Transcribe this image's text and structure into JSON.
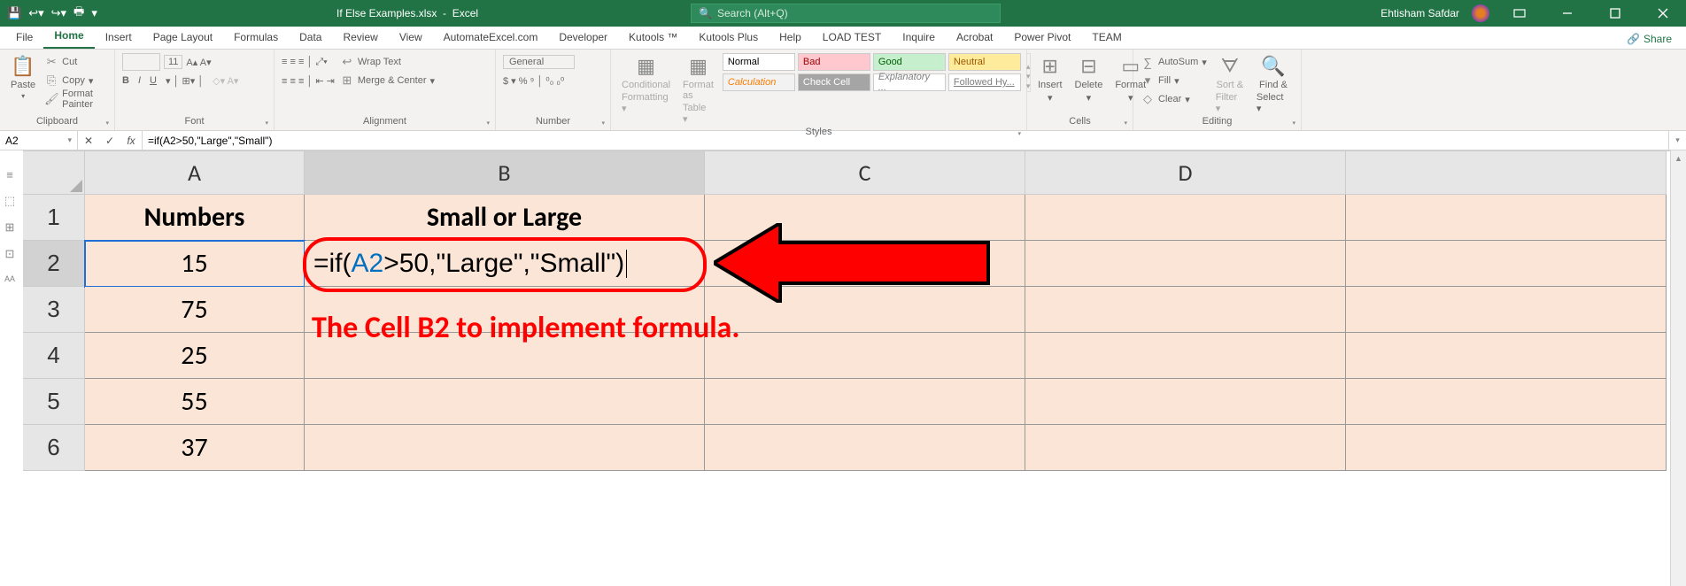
{
  "title": {
    "filename": "If Else Examples.xlsx",
    "app": "Excel"
  },
  "search": {
    "placeholder": "Search (Alt+Q)"
  },
  "user": {
    "name": "Ehtisham Safdar"
  },
  "menu": {
    "file": "File",
    "home": "Home",
    "insert": "Insert",
    "pageLayout": "Page Layout",
    "formulas": "Formulas",
    "data": "Data",
    "review": "Review",
    "view": "View",
    "automate": "AutomateExcel.com",
    "developer": "Developer",
    "kutools": "Kutools ™",
    "kutoolsPlus": "Kutools Plus",
    "help": "Help",
    "loadtest": "LOAD TEST",
    "inquire": "Inquire",
    "acrobat": "Acrobat",
    "powerpivot": "Power Pivot",
    "team": "TEAM",
    "share": "Share"
  },
  "ribbon": {
    "clipboard": {
      "label": "Clipboard",
      "paste": "Paste",
      "cut": "Cut",
      "copy": "Copy",
      "formatPainter": "Format Painter"
    },
    "font": {
      "label": "Font",
      "size": "11"
    },
    "alignment": {
      "label": "Alignment",
      "wrap": "Wrap Text",
      "merge": "Merge & Center"
    },
    "number": {
      "label": "Number",
      "general": "General"
    },
    "condfmt": {
      "cond": "Conditional",
      "cond2": "Formatting",
      "fas": "Format as",
      "fas2": "Table"
    },
    "styles": {
      "label": "Styles",
      "normal": "Normal",
      "bad": "Bad",
      "good": "Good",
      "neutral": "Neutral",
      "calc": "Calculation",
      "check": "Check Cell",
      "expl": "Explanatory ...",
      "follow": "Followed Hy..."
    },
    "cells": {
      "label": "Cells",
      "insert": "Insert",
      "delete": "Delete",
      "format": "Format"
    },
    "editing": {
      "label": "Editing",
      "autosum": "AutoSum",
      "fill": "Fill",
      "clear": "Clear",
      "sort": "Sort &",
      "sort2": "Filter",
      "find": "Find &",
      "find2": "Select"
    }
  },
  "namebox": "A2",
  "formula": "=if(A2>50,\"Large\",\"Small\")",
  "columns": {
    "A": "A",
    "B": "B",
    "C": "C",
    "D": "D"
  },
  "rows": [
    "1",
    "2",
    "3",
    "4",
    "5",
    "6"
  ],
  "sheet": {
    "A1": "Numbers",
    "B1": "Small or Large",
    "A2": "15",
    "A3": "75",
    "A4": "25",
    "A5": "55",
    "A6": "37",
    "B2_prefix": "=if(",
    "B2_ref": "A2",
    "B2_suffix": ">50,\"Large\",\"Small\")"
  },
  "annotation": "The Cell B2 to implement formula.",
  "chart_data": {
    "type": "table",
    "title": "Numbers / Small or Large",
    "columns": [
      "Numbers",
      "Small or Large"
    ],
    "categories": [
      "Row2",
      "Row3",
      "Row4",
      "Row5",
      "Row6"
    ],
    "series": [
      {
        "name": "Numbers",
        "values": [
          15,
          75,
          25,
          55,
          37
        ]
      }
    ],
    "formula_B2": "=if(A2>50,\"Large\",\"Small\")"
  }
}
